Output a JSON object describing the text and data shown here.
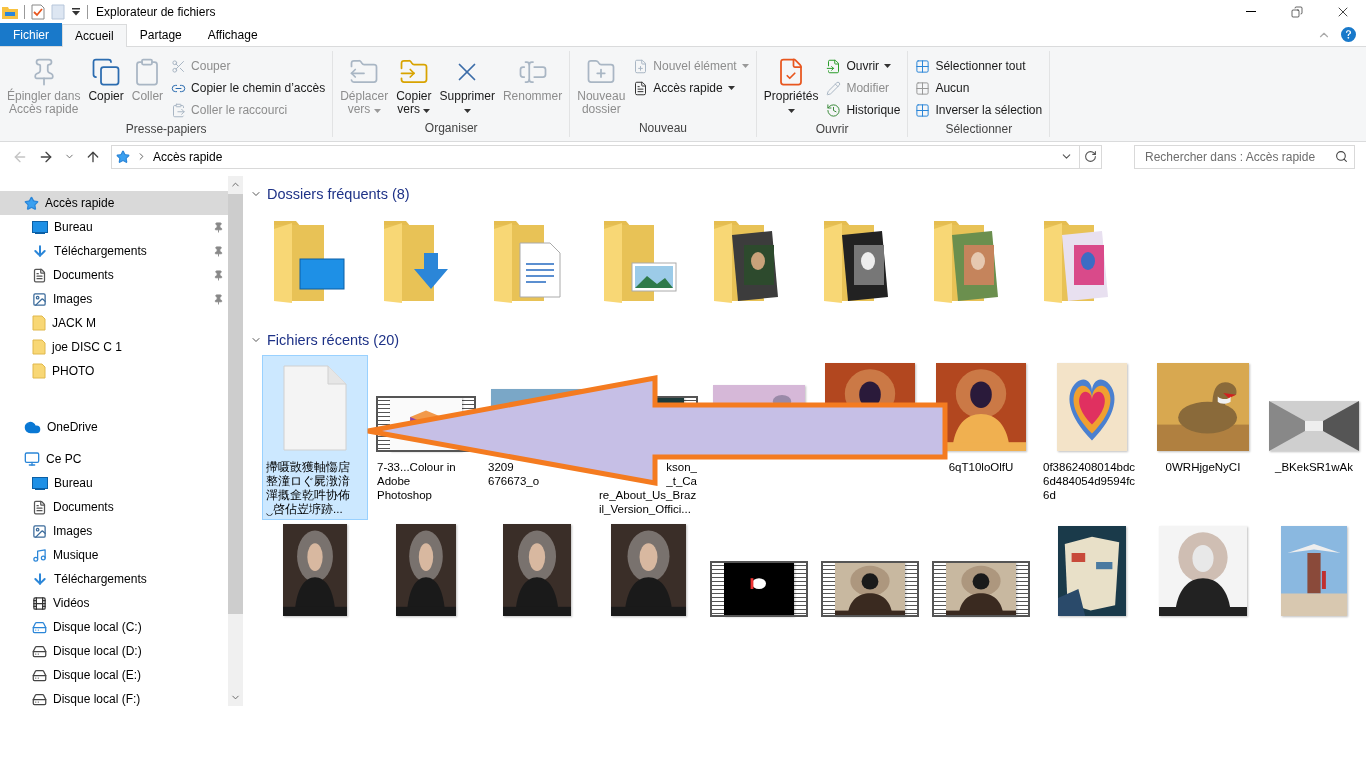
{
  "window": {
    "title": "Explorateur de fichiers"
  },
  "ribbon_tabs": [
    {
      "label": "Fichier",
      "kind": "file",
      "selected": false
    },
    {
      "label": "Accueil",
      "kind": "tab",
      "selected": true
    },
    {
      "label": "Partage",
      "kind": "tab",
      "selected": false
    },
    {
      "label": "Affichage",
      "kind": "tab",
      "selected": false
    }
  ],
  "ribbon": {
    "groups": [
      {
        "label": "Presse-papiers",
        "items": [
          {
            "kind": "large",
            "lines": [
              "Épingler dans",
              "Accès rapide"
            ],
            "disabled": true,
            "dropdown": false
          },
          {
            "kind": "large",
            "lines": [
              "Copier"
            ],
            "disabled": false,
            "dropdown": false
          },
          {
            "kind": "large",
            "lines": [
              "Coller"
            ],
            "disabled": true,
            "dropdown": false
          },
          {
            "kind": "stack",
            "rows": [
              {
                "label": "Couper",
                "disabled": true,
                "dropdown": false
              },
              {
                "label": "Copier le chemin d’accès",
                "disabled": false,
                "dropdown": false
              },
              {
                "label": "Coller le raccourci",
                "disabled": true,
                "dropdown": false
              }
            ]
          }
        ]
      },
      {
        "label": "Organiser",
        "items": [
          {
            "kind": "large",
            "lines": [
              "Déplacer",
              "vers"
            ],
            "disabled": true,
            "dropdown": true
          },
          {
            "kind": "large",
            "lines": [
              "Copier",
              "vers"
            ],
            "disabled": false,
            "dropdown": true
          },
          {
            "kind": "large",
            "lines": [
              "Supprimer"
            ],
            "disabled": false,
            "dropdown": true
          },
          {
            "kind": "large",
            "lines": [
              "Renommer"
            ],
            "disabled": true,
            "dropdown": false
          }
        ]
      },
      {
        "label": "Nouveau",
        "items": [
          {
            "kind": "large",
            "lines": [
              "Nouveau",
              "dossier"
            ],
            "disabled": true,
            "dropdown": false
          },
          {
            "kind": "stack",
            "rows": [
              {
                "label": "Nouvel élément",
                "disabled": true,
                "dropdown": true
              },
              {
                "label": "Accès rapide",
                "disabled": false,
                "dropdown": true
              }
            ]
          }
        ]
      },
      {
        "label": "Ouvrir",
        "items": [
          {
            "kind": "large",
            "lines": [
              "Propriétés"
            ],
            "disabled": false,
            "dropdown": true
          },
          {
            "kind": "stack",
            "rows": [
              {
                "label": "Ouvrir",
                "disabled": false,
                "dropdown": true
              },
              {
                "label": "Modifier",
                "disabled": true,
                "dropdown": false
              },
              {
                "label": "Historique",
                "disabled": false,
                "dropdown": false
              }
            ]
          }
        ]
      },
      {
        "label": "Sélectionner",
        "items": [
          {
            "kind": "stack",
            "rows": [
              {
                "label": "Sélectionner tout",
                "disabled": false,
                "dropdown": false
              },
              {
                "label": "Aucun",
                "disabled": false,
                "dropdown": false
              },
              {
                "label": "Inverser la sélection",
                "disabled": false,
                "dropdown": false
              }
            ]
          }
        ]
      }
    ]
  },
  "navigation": {
    "back": {
      "disabled": true
    },
    "forward": {
      "disabled": false
    }
  },
  "address": {
    "crumb": "Accès rapide"
  },
  "search": {
    "placeholder": "Rechercher dans : Accès rapide"
  },
  "sidebar": {
    "items": [
      {
        "label": "Accès rapide",
        "kind": "quick",
        "selected": true,
        "children": [
          {
            "label": "Bureau",
            "kind": "desktop",
            "pinned": true,
            "selected": false
          },
          {
            "label": "Téléchargements",
            "kind": "downloads",
            "pinned": true,
            "selected": false
          },
          {
            "label": "Documents",
            "kind": "documents",
            "pinned": true,
            "selected": false
          },
          {
            "label": "Images",
            "kind": "images",
            "pinned": true,
            "selected": false
          },
          {
            "label": "JACK M",
            "kind": "folder",
            "pinned": false,
            "selected": false
          },
          {
            "label": "joe DISC C 1",
            "kind": "folder",
            "pinned": false,
            "selected": false
          },
          {
            "label": "PHOTO",
            "kind": "folder",
            "pinned": false,
            "selected": false
          }
        ]
      },
      {
        "label": "OneDrive",
        "kind": "cloud",
        "selected": false
      },
      {
        "label": "Ce PC",
        "kind": "pc",
        "selected": false,
        "children": [
          {
            "label": "Bureau",
            "kind": "desktop",
            "pinned": false,
            "selected": false
          },
          {
            "label": "Documents",
            "kind": "documents",
            "pinned": false,
            "selected": false
          },
          {
            "label": "Images",
            "kind": "images",
            "pinned": false,
            "selected": false
          },
          {
            "label": "Musique",
            "kind": "music",
            "pinned": false,
            "selected": false
          },
          {
            "label": "Téléchargements",
            "kind": "downloads",
            "pinned": false,
            "selected": false
          },
          {
            "label": "Vidéos",
            "kind": "videos",
            "pinned": false,
            "selected": false
          },
          {
            "label": "Disque local (C:)",
            "kind": "system-drive",
            "pinned": false,
            "selected": false
          },
          {
            "label": "Disque local (D:)",
            "kind": "drive",
            "pinned": false,
            "selected": false
          },
          {
            "label": "Disque local (E:)",
            "kind": "drive",
            "pinned": false,
            "selected": false
          },
          {
            "label": "Disque local (F:)",
            "kind": "drive",
            "pinned": false,
            "selected": false
          }
        ]
      }
    ]
  },
  "frequent_folders": {
    "title": "Dossiers fréquents (8)",
    "expanded": true,
    "items": [
      {
        "kind": "desktop"
      },
      {
        "kind": "downloads"
      },
      {
        "kind": "documents"
      },
      {
        "kind": "images"
      },
      {
        "kind": "photos"
      },
      {
        "kind": "photos"
      },
      {
        "kind": "photos"
      },
      {
        "kind": "photos"
      }
    ]
  },
  "recent_files": {
    "title": "Fichiers récents (20)",
    "expanded": true,
    "items": [
      {
        "kind": "document",
        "selected": true,
        "lines": [
          "摕嗫敳獲軸慯扂",
          "整潼ロぐ屍潡湇",
          "潬摡佱乾吽协佈",
          "‿啓佔岦垿跡..."
        ]
      },
      {
        "kind": "video",
        "selected": false,
        "lines": [
          "7-33...Colour in",
          "Adobe",
          "Photoshop"
        ]
      },
      {
        "kind": "picture",
        "selected": false,
        "lines": [
          "3209",
          "676673_o"
        ]
      },
      {
        "kind": "video",
        "selected": false,
        "lines": [
          "kson_",
          "_t_Ca",
          "re_About_Us_Braz",
          "il_Version_Offici..."
        ]
      },
      {
        "kind": "picture",
        "selected": false
      },
      {
        "kind": "picture",
        "selected": false
      },
      {
        "kind": "picture",
        "selected": false,
        "lines": [
          "6qT10loOlfU"
        ]
      },
      {
        "kind": "picture",
        "selected": false,
        "lines": [
          "0f3862408014bdc",
          "6d484054d9594fc",
          "6d"
        ]
      },
      {
        "kind": "picture",
        "selected": false,
        "lines": [
          "0WRHjgeNyCI"
        ]
      },
      {
        "kind": "picture",
        "selected": false,
        "lines": [
          "_BKekSR1wAk"
        ]
      },
      {
        "kind": "picture",
        "selected": false
      },
      {
        "kind": "picture",
        "selected": false
      },
      {
        "kind": "picture",
        "selected": false
      },
      {
        "kind": "picture",
        "selected": false
      },
      {
        "kind": "video",
        "selected": false
      },
      {
        "kind": "video",
        "selected": false
      },
      {
        "kind": "video",
        "selected": false
      },
      {
        "kind": "picture",
        "selected": false
      },
      {
        "kind": "picture",
        "selected": false
      },
      {
        "kind": "picture",
        "selected": false
      }
    ]
  }
}
